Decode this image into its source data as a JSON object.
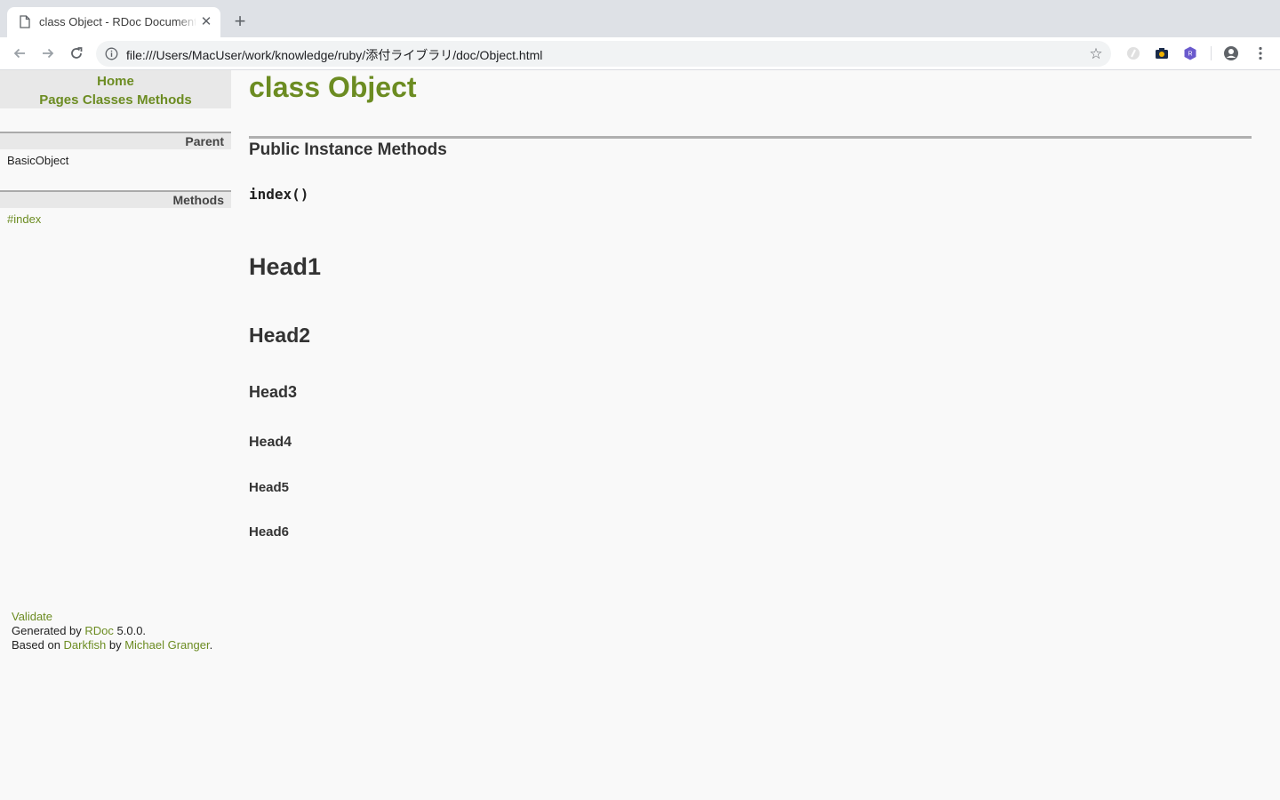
{
  "browser": {
    "tab_title": "class Object - RDoc Documentation",
    "url": "file:///Users/MacUser/work/knowledge/ruby/添付ライブラリ/doc/Object.html"
  },
  "nav": {
    "home": "Home",
    "pages": "Pages",
    "classes": "Classes",
    "methods": "Methods"
  },
  "sidebar": {
    "parent_heading": "Parent",
    "parent_value": "BasicObject",
    "methods_heading": "Methods",
    "methods_items": [
      "#index"
    ]
  },
  "main": {
    "title": "class Object",
    "section_title": "Public Instance Methods",
    "method_signature": "index()",
    "headings": [
      "Head1",
      "Head2",
      "Head3",
      "Head4",
      "Head5",
      "Head6"
    ]
  },
  "footer": {
    "validate": "Validate",
    "generated_prefix": "Generated by ",
    "rdoc_link": "RDoc",
    "version_suffix": " 5.0.0.",
    "based_prefix": "Based on ",
    "darkfish_link": "Darkfish",
    "by_text": " by ",
    "author_link": "Michael Granger",
    "period": "."
  },
  "colors": {
    "link_green": "#6c8c22",
    "sidebar_bg": "#e8e8e8",
    "page_bg": "#f9f9f9"
  },
  "icons": {
    "tab_favicon": "document-icon",
    "tab_close": "close-icon",
    "new_tab": "plus-icon",
    "back": "arrow-left-icon",
    "forward": "arrow-right-icon",
    "reload": "reload-icon",
    "site_info": "info-icon",
    "bookmark": "star-icon",
    "extensions": [
      "extension-icon",
      "camera-extension-icon",
      "shield-extension-icon"
    ],
    "profile": "profile-icon",
    "menu": "kebab-menu-icon"
  }
}
